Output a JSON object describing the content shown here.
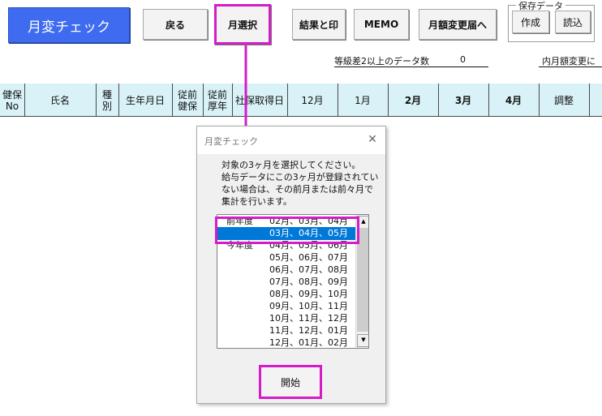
{
  "toolbar": {
    "title": "月変チェック",
    "back": "戻る",
    "month_select": "月選択",
    "result_print": "結果と印",
    "memo": "MEMO",
    "monthly_change": "月額変更届へ",
    "save_group_label": "保存データ",
    "create": "作成",
    "load": "読込"
  },
  "info": {
    "grade_diff_label": "等級差2以上のデータ数",
    "grade_diff_count": "0",
    "change_label": "内月額変更に"
  },
  "table": {
    "headers": [
      {
        "line1": "健保",
        "line2": "No"
      },
      {
        "line1": "氏名",
        "line2": ""
      },
      {
        "line1": "種",
        "line2": "別"
      },
      {
        "line1": "生年月日",
        "line2": ""
      },
      {
        "line1": "従前",
        "line2": "健保"
      },
      {
        "line1": "従前",
        "line2": "厚年"
      },
      {
        "line1": "社保取得日",
        "line2": ""
      },
      {
        "line1": "12月",
        "line2": ""
      },
      {
        "line1": "1月",
        "line2": ""
      },
      {
        "line1": "2月",
        "line2": ""
      },
      {
        "line1": "3月",
        "line2": ""
      },
      {
        "line1": "4月",
        "line2": ""
      },
      {
        "line1": "調整",
        "line2": ""
      }
    ]
  },
  "dialog": {
    "title": "月変チェック",
    "close": "✕",
    "instructions": [
      "対象の3ヶ月を選択してください。",
      "給与データにこの3ヶ月が登録されてい",
      "ない場合は、その前月または前々月で",
      "集計を行います。"
    ],
    "options": [
      {
        "label": "前年度",
        "months": "02月、03月、04月"
      },
      {
        "label": "",
        "months": "03月、04月、05月"
      },
      {
        "label": "今年度",
        "months": "04月、05月、06月"
      },
      {
        "label": "",
        "months": "05月、06月、07月"
      },
      {
        "label": "",
        "months": "06月、07月、08月"
      },
      {
        "label": "",
        "months": "07月、08月、09月"
      },
      {
        "label": "",
        "months": "08月、09月、10月"
      },
      {
        "label": "",
        "months": "09月、10月、11月"
      },
      {
        "label": "",
        "months": "10月、11月、12月"
      },
      {
        "label": "",
        "months": "11月、12月、01月"
      },
      {
        "label": "",
        "months": "12月、01月、02月"
      }
    ],
    "selected_index": 1,
    "start": "開始"
  },
  "colors": {
    "highlight": "#d41cc8",
    "title_button": "#3e6bf0",
    "header_bg": "#d9f2f7",
    "selection": "#0078d7"
  }
}
